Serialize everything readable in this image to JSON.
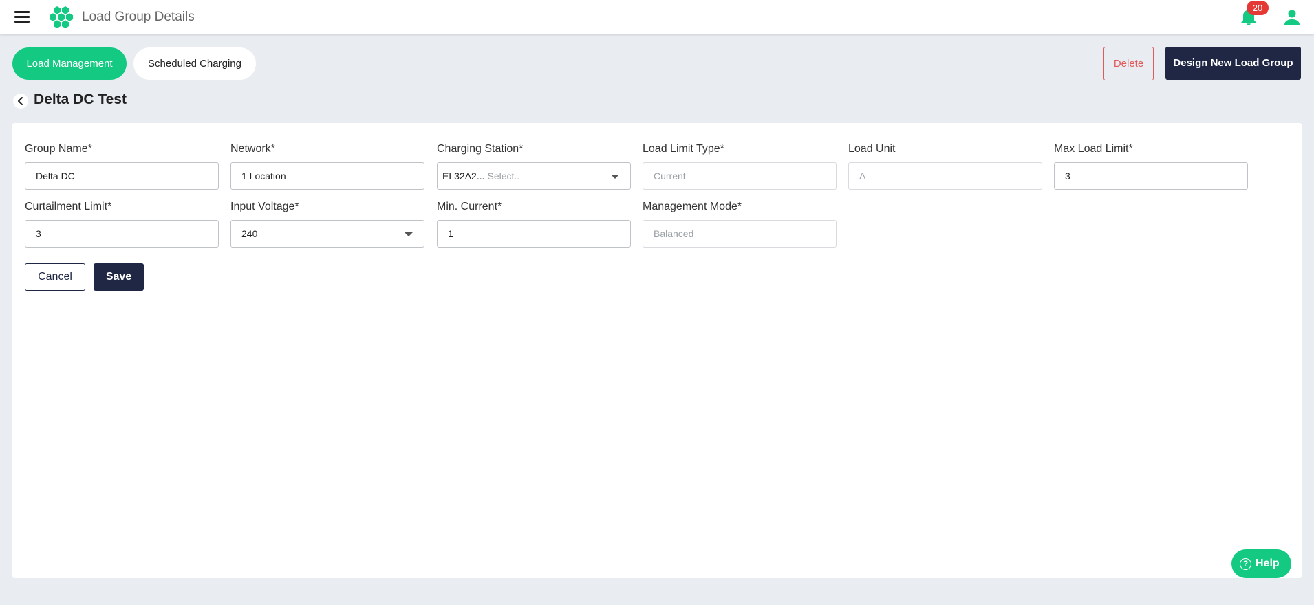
{
  "header": {
    "title": "Load Group Details",
    "notification_count": "20",
    "brand_color": "#14c981"
  },
  "tabs": [
    {
      "label": "Load Management",
      "active": true
    },
    {
      "label": "Scheduled Charging",
      "active": false
    }
  ],
  "actions": {
    "delete_label": "Delete",
    "design_label": "Design New Load Group"
  },
  "page": {
    "title": "Delta DC Test"
  },
  "form": {
    "group_name": {
      "label": "Group Name*",
      "value": "Delta DC"
    },
    "network": {
      "label": "Network*",
      "value": "1 Location"
    },
    "charging_station": {
      "label": "Charging Station*",
      "value": "EL32A2...",
      "placeholder": "Select.."
    },
    "load_limit_type": {
      "label": "Load Limit Type*",
      "value": "Current"
    },
    "load_unit": {
      "label": "Load Unit",
      "value": "A"
    },
    "max_load_limit": {
      "label": "Max Load Limit*",
      "value": "3"
    },
    "curtailment_limit": {
      "label": "Curtailment Limit*",
      "value": "3"
    },
    "input_voltage": {
      "label": "Input Voltage*",
      "value": "240"
    },
    "min_current": {
      "label": "Min. Current*",
      "value": "1"
    },
    "management_mode": {
      "label": "Management Mode*",
      "value": "Balanced"
    },
    "cancel_label": "Cancel",
    "save_label": "Save"
  },
  "help": {
    "label": "Help"
  }
}
